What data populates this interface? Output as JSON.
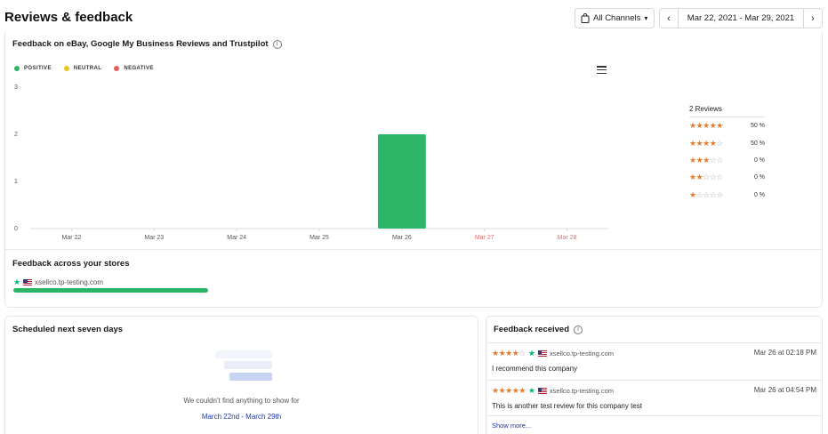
{
  "header": {
    "title": "Reviews & feedback",
    "channels_label": "All Channels",
    "date_range": "Mar 22, 2021 - Mar 29, 2021",
    "prev_label": "‹",
    "next_label": "›"
  },
  "chart_card": {
    "title": "Feedback on eBay, Google My Business Reviews and Trustpilot",
    "legend": [
      {
        "label": "POSITIVE",
        "color": "#2db567"
      },
      {
        "label": "NEUTRAL",
        "color": "#f3c21a"
      },
      {
        "label": "NEGATIVE",
        "color": "#e35d5d"
      }
    ]
  },
  "chart_data": {
    "type": "bar",
    "categories": [
      "Mar 22",
      "Mar 23",
      "Mar 24",
      "Mar 25",
      "Mar 26",
      "Mar 27",
      "Mar 28"
    ],
    "category_colors": [
      "#555555",
      "#555555",
      "#555555",
      "#555555",
      "#555555",
      "#e07070",
      "#e07070"
    ],
    "series": [
      {
        "name": "POSITIVE",
        "color": "#2db567",
        "values": [
          0,
          0,
          0,
          0,
          2,
          0,
          0
        ]
      },
      {
        "name": "NEUTRAL",
        "color": "#f3c21a",
        "values": [
          0,
          0,
          0,
          0,
          0,
          0,
          0
        ]
      },
      {
        "name": "NEGATIVE",
        "color": "#e35d5d",
        "values": [
          0,
          0,
          0,
          0,
          0,
          0,
          0
        ]
      }
    ],
    "yticks": [
      0,
      1,
      2,
      3
    ],
    "ylim": [
      0,
      3
    ],
    "stacked": true,
    "legend_position": "top-left",
    "grid": false
  },
  "rating_summary": {
    "total_label": "2 Reviews",
    "rows": [
      {
        "stars": 5,
        "percent": "50 %"
      },
      {
        "stars": 4,
        "percent": "50 %"
      },
      {
        "stars": 3,
        "percent": "0 %"
      },
      {
        "stars": 2,
        "percent": "0 %"
      },
      {
        "stars": 1,
        "percent": "0 %"
      }
    ]
  },
  "stores": {
    "title": "Feedback across your stores",
    "items": [
      {
        "name": "xsellco.tp-testing.com",
        "share": 1.0,
        "color": "#2db567"
      }
    ]
  },
  "scheduled": {
    "title": "Scheduled next seven days",
    "empty_message": "We couldn't find anything to show for",
    "empty_range": "March 22nd - March 29th"
  },
  "feedback_received": {
    "title": "Feedback received",
    "reviews": [
      {
        "stars": 4,
        "store": "xsellco.tp-testing.com",
        "date": "Mar 26 at 02:18 PM",
        "text": "I recommend this company"
      },
      {
        "stars": 5,
        "store": "xsellco.tp-testing.com",
        "date": "Mar 26 at 04:54 PM",
        "text": "This is another test review for this company test"
      }
    ],
    "show_more_label": "Show more..."
  }
}
